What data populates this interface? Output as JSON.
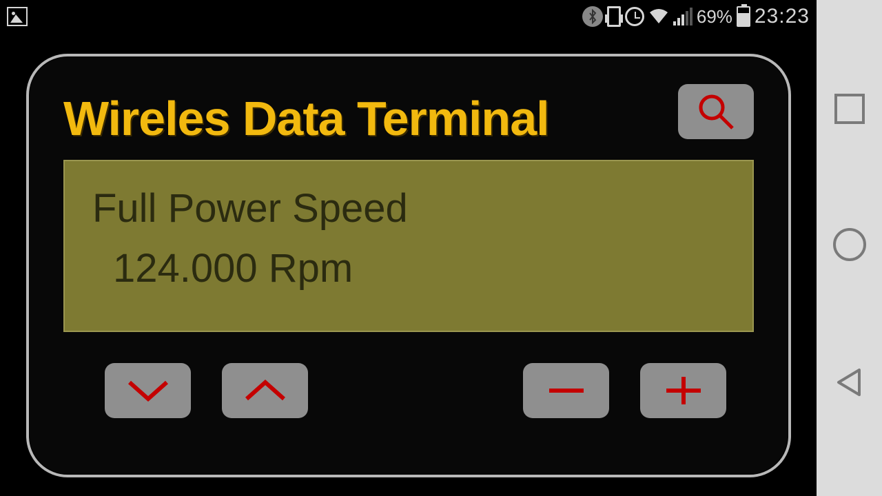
{
  "status_bar": {
    "battery_pct": "69%",
    "time": "23:23"
  },
  "panel": {
    "title": "Wireles Data Terminal",
    "display": {
      "line1": "Full Power Speed",
      "line2": "124.000 Rpm"
    }
  }
}
